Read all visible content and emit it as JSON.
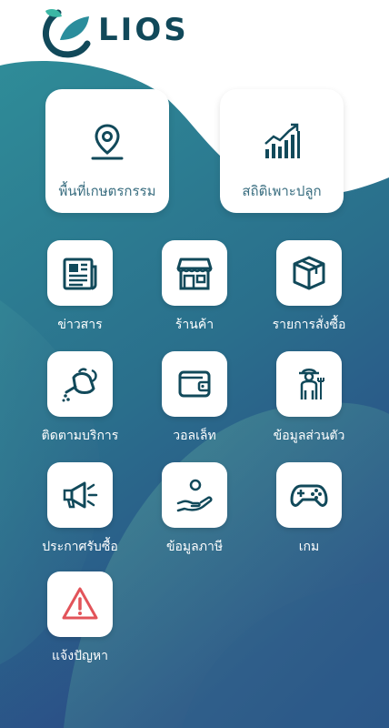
{
  "app": {
    "logo_text": "LIOS"
  },
  "big_cards": [
    {
      "label": "พื้นที่เกษตรกรรม",
      "icon": "map-pin-icon"
    },
    {
      "label": "สถิติเพาะปลูก",
      "icon": "growth-chart-icon"
    }
  ],
  "menu": [
    {
      "label": "ข่าวสาร",
      "icon": "newspaper-icon"
    },
    {
      "label": "ร้านค้า",
      "icon": "store-icon"
    },
    {
      "label": "รายการสั่งซื้อ",
      "icon": "package-icon"
    },
    {
      "label": "ติดตามบริการ",
      "icon": "watering-can-icon"
    },
    {
      "label": "วอลเล็ท",
      "icon": "wallet-icon"
    },
    {
      "label": "ข้อมูลส่วนตัว",
      "icon": "farmer-icon"
    },
    {
      "label": "ประกาศรับซื้อ",
      "icon": "megaphone-icon"
    },
    {
      "label": "ข้อมูลภาษี",
      "icon": "hand-person-icon"
    },
    {
      "label": "เกม",
      "icon": "gamepad-icon"
    },
    {
      "label": "แจ้งปัญหา",
      "icon": "warning-icon"
    }
  ],
  "colors": {
    "primary_dark": "#11495a",
    "teal": "#3a8a98",
    "warning": "#e2545a",
    "leaf": "#3bb6a4"
  }
}
